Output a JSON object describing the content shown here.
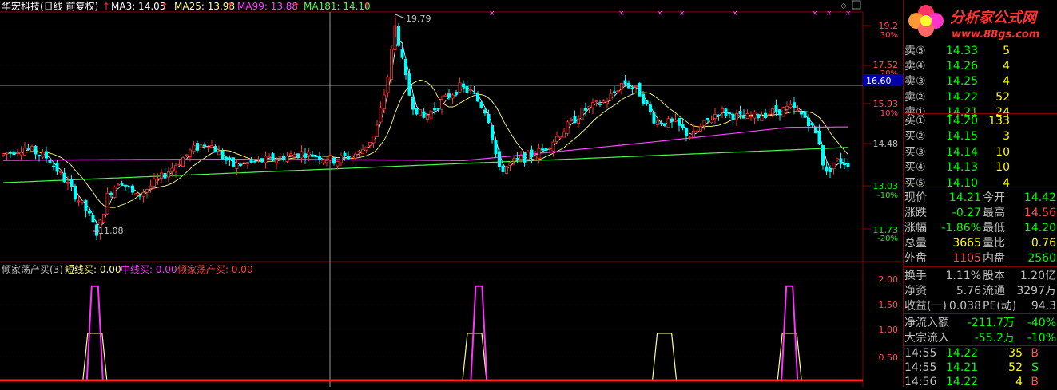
{
  "header": {
    "stock_title": "华宏科技(日线 前复权)",
    "ma3": "MA3: 14.05",
    "ma25": "MA25: 13.98",
    "ma99": "MA99: 13.88",
    "ma181": "MA181: 14.10"
  },
  "price_axis": {
    "labels": [
      "19.2",
      "30%",
      "17.52",
      "20%",
      "15.93",
      "10%",
      "14.48",
      "13.03",
      "-10%",
      "11.73",
      "-20%"
    ],
    "crosshair_value": "16.60"
  },
  "annotations": {
    "high": "19.79",
    "low": "11.08"
  },
  "indicator": {
    "title": "倾家荡产买(3)",
    "short_label": "短线买: 0.00",
    "mid_label": "中线买: 0.00",
    "main_label": "倾家荡产买: 0.00",
    "axis": [
      "2.00",
      "1.50",
      "1.00",
      "0.50"
    ]
  },
  "logo": {
    "name": "分析家公式网",
    "url": "www.88gs.com"
  },
  "order_book": {
    "sell": [
      {
        "label": "卖⑤",
        "price": "14.33",
        "vol": "5"
      },
      {
        "label": "卖④",
        "price": "14.26",
        "vol": "4"
      },
      {
        "label": "卖③",
        "price": "14.25",
        "vol": "4"
      },
      {
        "label": "卖②",
        "price": "14.22",
        "vol": "52"
      },
      {
        "label": "卖①",
        "price": "14.21",
        "vol": "24"
      }
    ],
    "buy": [
      {
        "label": "买①",
        "price": "14.20",
        "vol": "133"
      },
      {
        "label": "买②",
        "price": "14.15",
        "vol": "3"
      },
      {
        "label": "买③",
        "price": "14.14",
        "vol": "10"
      },
      {
        "label": "买④",
        "price": "14.13",
        "vol": "10"
      },
      {
        "label": "买⑤",
        "price": "14.10",
        "vol": "4"
      }
    ]
  },
  "quote": [
    {
      "l1": "现价",
      "v1": "14.21",
      "c1": "#00ff00",
      "l2": "今开",
      "v2": "14.42",
      "c2": "#00ff00"
    },
    {
      "l1": "涨跌",
      "v1": "-0.27",
      "c1": "#00ff00",
      "l2": "最高",
      "v2": "14.56",
      "c2": "#ff5050"
    },
    {
      "l1": "涨幅",
      "v1": "-1.86%",
      "c1": "#00ff00",
      "l2": "最低",
      "v2": "14.20",
      "c2": "#00ff00"
    },
    {
      "l1": "总量",
      "v1": "3665",
      "c1": "#ffff00",
      "l2": "量比",
      "v2": "0.76",
      "c2": "#ffff00"
    },
    {
      "l1": "外盘",
      "v1": "1105",
      "c1": "#ff5050",
      "l2": "内盘",
      "v2": "2560",
      "c2": "#00ff00"
    }
  ],
  "stats": [
    {
      "l1": "换手",
      "v1": "1.11%",
      "l2": "股本",
      "v2": "1.20亿"
    },
    {
      "l1": "净资",
      "v1": "5.76",
      "l2": "流通",
      "v2": "3297万"
    },
    {
      "l1": "收益(一)",
      "v1": "0.038",
      "l2": "PE(动)",
      "v2": "94.3"
    }
  ],
  "flow": [
    {
      "label": "净流入额",
      "val": "-211.7万",
      "pct": "-40%"
    },
    {
      "label": "大宗流入",
      "val": "-55.2万",
      "pct": "-10%"
    }
  ],
  "trades": [
    {
      "time": "14:55",
      "price": "14.22",
      "vol": "35",
      "side": "B",
      "color": "#ff5050"
    },
    {
      "time": "14:55",
      "price": "14.21",
      "vol": "52",
      "side": "S",
      "color": "#00ff00"
    },
    {
      "time": "14:56",
      "price": "14.22",
      "vol": "4",
      "side": "B",
      "color": "#ff5050"
    }
  ],
  "colors": {
    "up": "#ff3030",
    "down": "#00ffff",
    "ma3": "#ffffff",
    "ma25": "#ffff88",
    "ma99": "#ff44ff",
    "ma181": "#44ff44",
    "frame": "#8b0000",
    "short": "#ffff88",
    "mid": "#ff33ff",
    "main": "#ff2020"
  },
  "chart_data": [
    {
      "type": "candlestick",
      "title": "华宏科技(日线 前复权)",
      "ylim": [
        11.3,
        19.9
      ],
      "annotations": {
        "high": 19.79,
        "low": 11.08
      }
    },
    {
      "type": "line",
      "title": "倾家荡产买(3)",
      "ylim": [
        0,
        2.2
      ],
      "series": [
        {
          "name": "短线买",
          "peaks": [
            {
              "x": 0.11,
              "value": 1.0
            },
            {
              "x": 0.55,
              "value": 1.0
            },
            {
              "x": 0.77,
              "value": 1.0
            },
            {
              "x": 0.915,
              "value": 1.0
            }
          ]
        },
        {
          "name": "中线买",
          "peaks": [
            {
              "x": 0.11,
              "value": 2.0
            },
            {
              "x": 0.555,
              "value": 2.0
            },
            {
              "x": 0.915,
              "value": 2.0
            }
          ]
        },
        {
          "name": "倾家荡产买",
          "values_all": 0.0
        }
      ]
    }
  ]
}
